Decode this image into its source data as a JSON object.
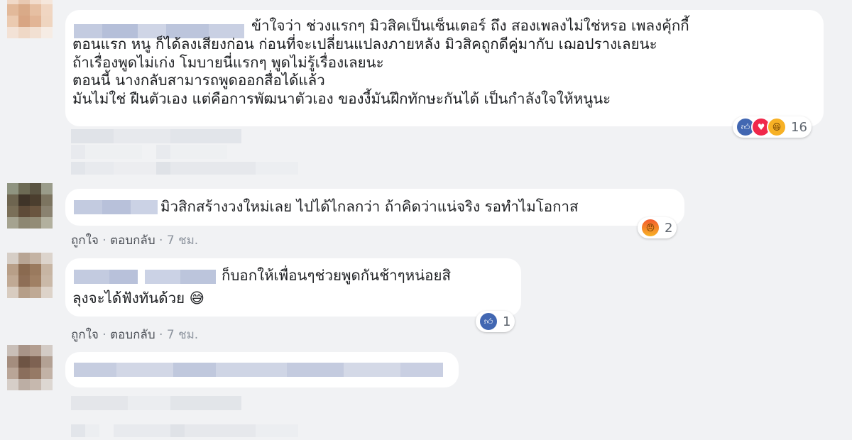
{
  "comments": [
    {
      "text_lines": [
        "ข้าใจว่า ช่วงแรกๆ มิวสิคเป็นเซ็นเตอร์ ถึง สองเพลงไม่ใช่หรอ เพลงคุ้กกี้",
        "ตอนแรก หนู ก็ได้ลงเสียงก่อน ก่อนที่จะเปลี่ยนแปลงภายหลัง มิวสิคถูกดีคู่มากับ เฌอปรางเลยนะ",
        "ถ้าเรื่องพูดไม่เก่ง โมบายนี่แรกๆ พูดไม่รู้เรื่องเลยนะ",
        "ตอนนี้ นางกลับสามารถพูดออกสื่อได้แล้ว",
        "มันไม่ใช่ ฝืนตัวเอง แต่คือการพัฒนาตัวเอง ของงี้มันฝึกทักษะกันได้ เป็นกำลังใจให้หนูนะ"
      ],
      "reactions": [
        "like-icon",
        "love-icon",
        "haha-icon"
      ],
      "reaction_count": "16"
    },
    {
      "text_lines": [
        "มิวสิกสร้างวงใหม่เลย ไปได้ไกลกว่า ถ้าคิดว่าแน่จริง รอทำไมโอกาส"
      ],
      "reactions": [
        "angry-icon"
      ],
      "reaction_count": "2",
      "meta": {
        "like": "ถูกใจ",
        "sep": " · ",
        "reply": "ตอบกลับ",
        "time": "7 ชม."
      }
    },
    {
      "text_lines": [
        "ก็บอกให้เพื่อนๆช่วยพูดกันช้าๆหน่อยสิ",
        "ลุงจะได้ฟังทันด้วย 😅"
      ],
      "reactions": [
        "like-icon"
      ],
      "reaction_count": "1",
      "meta": {
        "like": "ถูกใจ",
        "sep": " · ",
        "reply": "ตอบกลับ",
        "time": "7 ชม."
      }
    }
  ],
  "colors": {
    "background": "#f1f2f4",
    "bubble": "#ffffff",
    "like": "#4267b2",
    "love": "#f0284a",
    "haha": "#f7b125",
    "meta_text": "#8d949e"
  }
}
